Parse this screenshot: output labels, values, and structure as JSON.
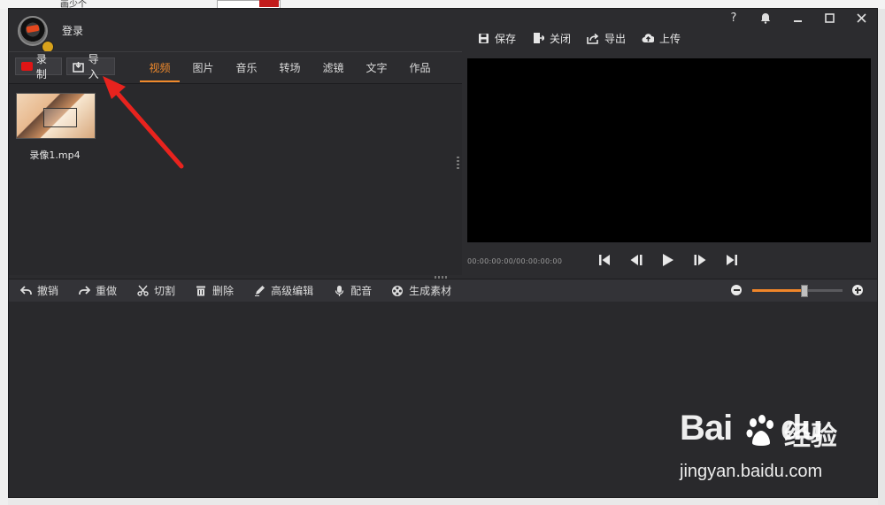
{
  "background": {
    "top_text": "画少个"
  },
  "titlebar": {
    "login": "登录",
    "window_buttons": [
      "?",
      "◆",
      "—",
      "□",
      "✕"
    ],
    "toolbar": [
      {
        "label": "保存",
        "icon": "save-icon"
      },
      {
        "label": "关闭",
        "icon": "exit-icon"
      },
      {
        "label": "导出",
        "icon": "share-icon"
      },
      {
        "label": "上传",
        "icon": "cloud-upload-icon"
      }
    ]
  },
  "left": {
    "record_label": "录制",
    "import_label": "导入",
    "tabs": [
      "视频",
      "图片",
      "音乐",
      "转场",
      "滤镜",
      "文字",
      "作品"
    ],
    "active_tab": 0,
    "media": [
      {
        "name": "录像1.mp4"
      }
    ]
  },
  "player": {
    "timecode": "00:00:00:00/00:00:00:00"
  },
  "editbar": {
    "items": [
      {
        "label": "撤销",
        "icon": "undo-icon"
      },
      {
        "label": "重做",
        "icon": "redo-icon"
      },
      {
        "label": "切割",
        "icon": "scissors-icon"
      },
      {
        "label": "删除",
        "icon": "trash-icon"
      },
      {
        "label": "高级编辑",
        "icon": "pencil-icon"
      },
      {
        "label": "配音",
        "icon": "microphone-icon"
      },
      {
        "label": "生成素材",
        "icon": "film-reel-icon"
      }
    ],
    "zoom_level": 0.57
  },
  "watermark": {
    "brand": "Bai",
    "brand2": "du",
    "cn": "经验",
    "url": "jingyan.baidu.com"
  },
  "colors": {
    "accent": "#f08a2c",
    "record": "#e01515",
    "annotation": "#e8231e"
  }
}
